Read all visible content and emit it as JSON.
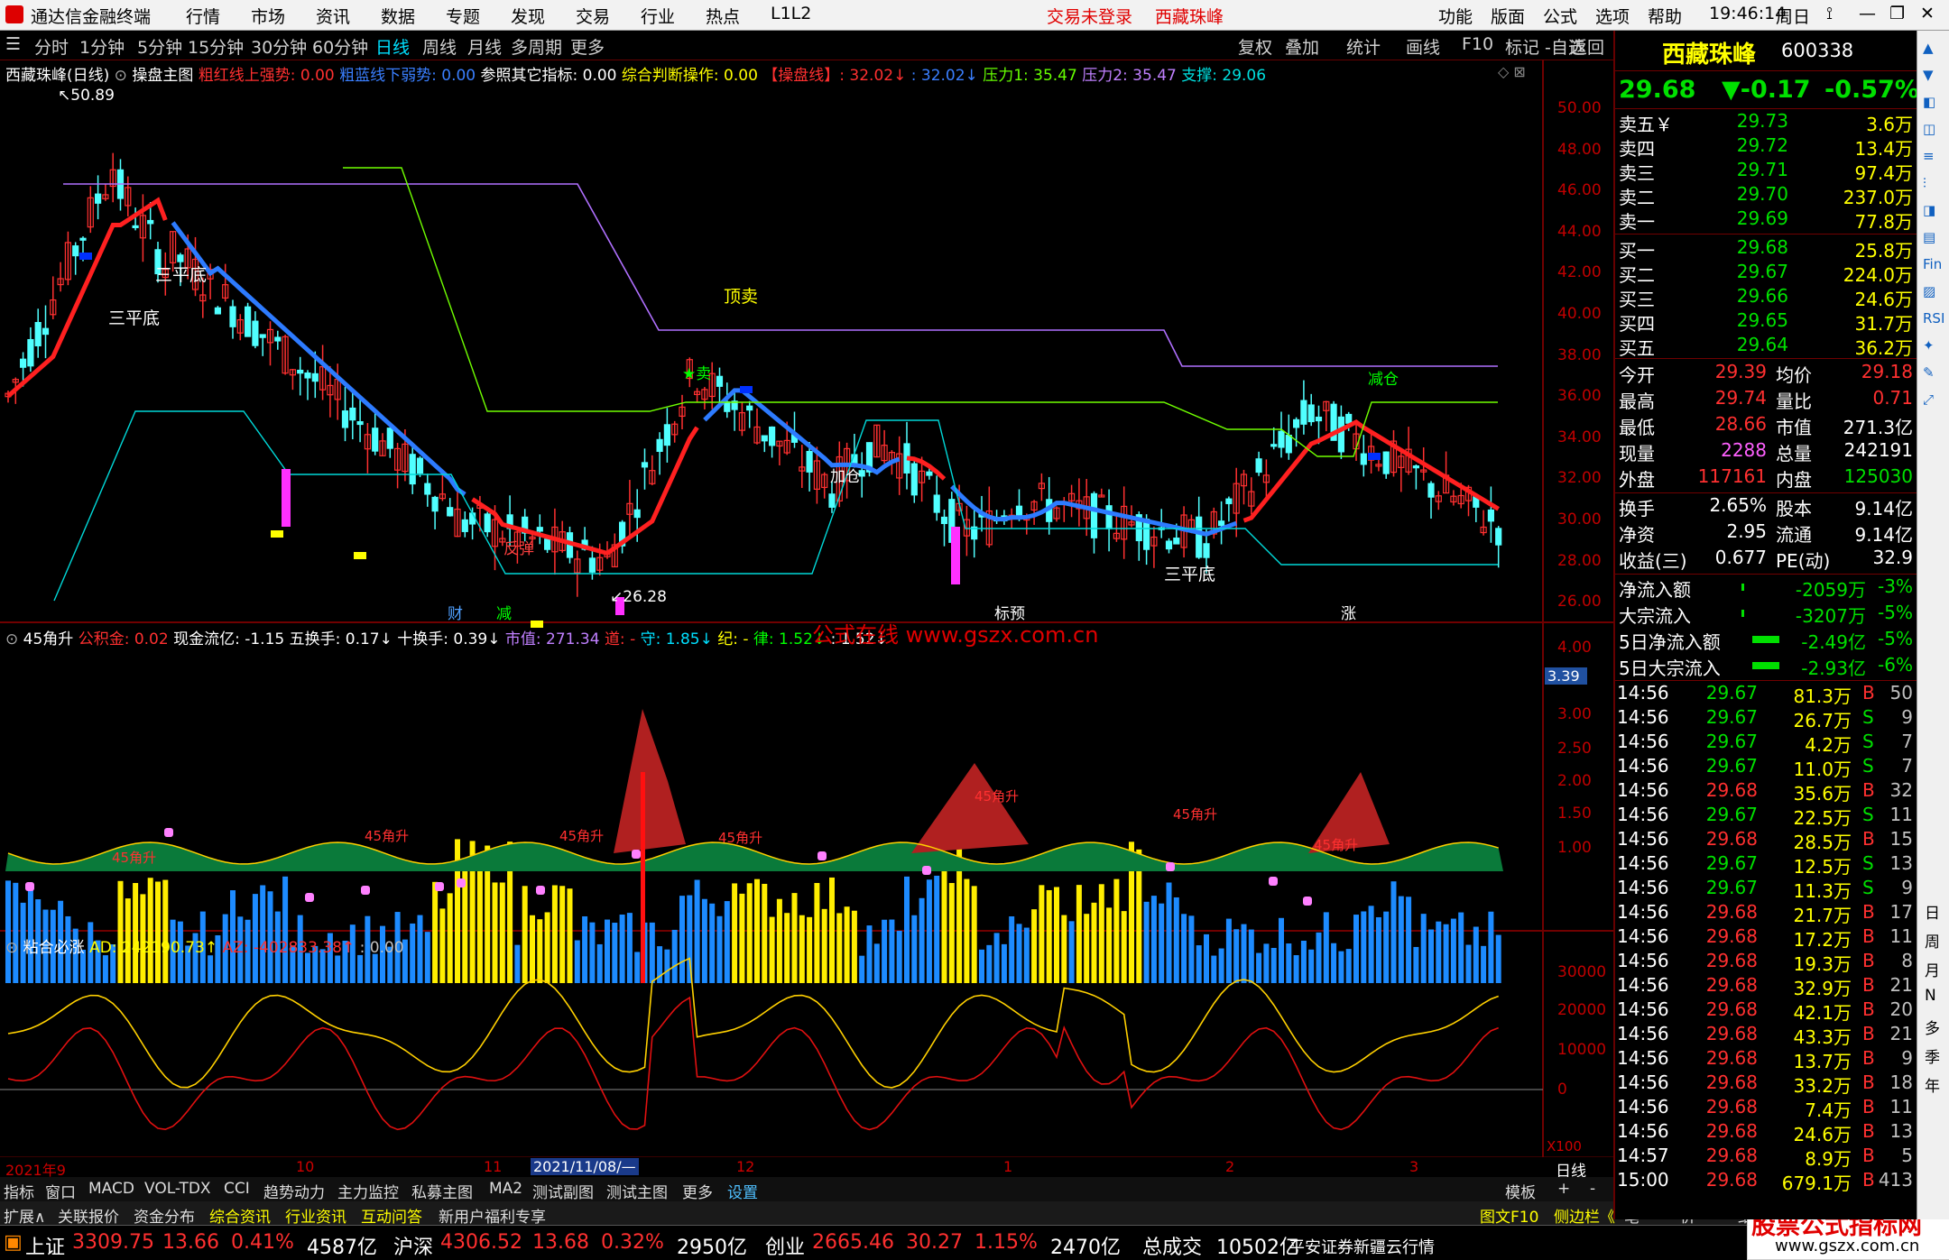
{
  "titlebar": {
    "app_name": "通达信金融终端",
    "menu": [
      "行情",
      "市场",
      "资讯",
      "数据",
      "专题",
      "发现",
      "交易",
      "行业",
      "热点",
      "L1L2"
    ],
    "login_status": "交易未登录",
    "stock_name": "西藏珠峰",
    "right_menu": [
      "功能",
      "版面",
      "公式",
      "选项",
      "帮助"
    ],
    "time": "19:46:14",
    "weekday": "周日"
  },
  "toolbar": {
    "periods": [
      "分时",
      "1分钟",
      "5分钟",
      "15分钟",
      "30分钟",
      "60分钟",
      "日线",
      "周线",
      "月线",
      "多周期",
      "更多"
    ],
    "active": "日线",
    "right_buttons": [
      "复权",
      "叠加",
      "统计",
      "画线",
      "F10",
      "标记",
      "-自选",
      "返回"
    ]
  },
  "main_chart": {
    "header": {
      "title": "西藏珠峰(日线)",
      "formula": "操盘主图",
      "items": [
        {
          "t": "粗红线上强势: 0.00",
          "c": "#ff3030"
        },
        {
          "t": "粗蓝线下弱势: 0.00",
          "c": "#3a7fff"
        },
        {
          "t": "参照其它指标: 0.00",
          "c": "#ffffff"
        },
        {
          "t": "综合判断操作: 0.00",
          "c": "#ffff00"
        },
        {
          "t": "【操盘线】: 32.02↓",
          "c": "#ff3030"
        },
        {
          "t": ": 32.02↓",
          "c": "#3a7fff"
        },
        {
          "t": "压力1: 35.47",
          "c": "#66ff00"
        },
        {
          "t": "压力2: 35.47",
          "c": "#c080ff"
        },
        {
          "t": "支撑: 29.06",
          "c": "#00e0e0"
        }
      ]
    },
    "y_labels": [
      "50.00",
      "48.00",
      "46.00",
      "44.00",
      "42.00",
      "40.00",
      "38.00",
      "36.00",
      "34.00",
      "32.00",
      "30.00",
      "28.00",
      "26.00"
    ],
    "high_label": "50.89",
    "low_label": "26.28",
    "annotations": [
      {
        "t": "三平底",
        "c": "#ffffff"
      },
      {
        "t": "三平底",
        "c": "#ffffff"
      },
      {
        "t": "顶卖",
        "c": "#ffff00"
      },
      {
        "t": "★卖",
        "c": "#00ff00"
      },
      {
        "t": "减仓",
        "c": "#ffffff"
      },
      {
        "t": "三平底",
        "c": "#ffffff"
      },
      {
        "t": "反弹",
        "c": "#ff4040"
      },
      {
        "t": "加仓",
        "c": "#ffffff"
      },
      {
        "t": "财",
        "c": "#4fa0ff"
      },
      {
        "t": "减",
        "c": "#00ff00"
      },
      {
        "t": "标预",
        "c": "#ffffff"
      },
      {
        "t": "涨",
        "c": "#ffffff"
      }
    ]
  },
  "ind1": {
    "title": "45角升",
    "items": [
      {
        "t": "公积金: 0.02",
        "c": "#ff3030"
      },
      {
        "t": "现金流亿: -1.15",
        "c": "#ffffff"
      },
      {
        "t": "五换手: 0.17↓",
        "c": "#ffffff"
      },
      {
        "t": "十换手: 0.39↓",
        "c": "#ffffff"
      },
      {
        "t": "市值: 271.34",
        "c": "#c080ff"
      },
      {
        "t": "道: -",
        "c": "#ff3030"
      },
      {
        "t": "守: 1.85↓",
        "c": "#00e0ff"
      },
      {
        "t": "纪: -",
        "c": "#ffff00"
      },
      {
        "t": "律: 1.52↓",
        "c": "#00ff00"
      },
      {
        "t": ": 1.52↓",
        "c": "#ffffff"
      }
    ],
    "watermark": "公式在线   www.gszx.com.cn",
    "y_labels": [
      "4.00",
      "3.00",
      "2.50",
      "2.00",
      "1.50",
      "1.00"
    ],
    "current_value": "3.39",
    "bar_label": "45角升"
  },
  "ind2": {
    "title": "粘合必涨",
    "items": [
      {
        "t": "AD: 242190.73↑",
        "c": "#ffff00"
      },
      {
        "t": "AZ: -402833.38↑",
        "c": "#ff3030"
      },
      {
        "t": ": 0.00",
        "c": "#c0c0c0"
      }
    ],
    "y_labels": [
      "30000",
      "20000",
      "10000",
      "0"
    ],
    "scale_label": "X100"
  },
  "xaxis": {
    "labels": [
      "2021年9",
      "10",
      "11",
      "2021/11/08/—",
      "12",
      "1",
      "2",
      "3"
    ],
    "period_label": "日线"
  },
  "tabs": [
    "指标",
    "窗口",
    "MACD",
    "VOL-TDX",
    "CCI",
    "趋势动力",
    "主力监控",
    "私募主图",
    "MA2",
    "测试副图",
    "测试主图",
    "更多",
    "设置"
  ],
  "tabs_right": [
    "模板",
    "+",
    "-"
  ],
  "tabs2": [
    "扩展∧",
    "关联报价",
    "资金分布",
    "综合资讯",
    "行业资讯",
    "互动问答",
    "新用户福利专享"
  ],
  "tabs2_right": [
    "图文F10",
    "侧边栏《",
    "笔",
    "价",
    "细",
    "势"
  ],
  "quote": {
    "name": "西藏珠峰",
    "code": "600338",
    "price": "29.68",
    "change": "▼-0.17",
    "pct": "-0.57%",
    "asks": [
      {
        "l": "卖五￥",
        "p": "29.73",
        "v": "3.6万"
      },
      {
        "l": "卖四",
        "p": "29.72",
        "v": "13.4万"
      },
      {
        "l": "卖三",
        "p": "29.71",
        "v": "97.4万"
      },
      {
        "l": "卖二",
        "p": "29.70",
        "v": "237.0万"
      },
      {
        "l": "卖一",
        "p": "29.69",
        "v": "77.8万"
      }
    ],
    "bids": [
      {
        "l": "买一",
        "p": "29.68",
        "v": "25.8万"
      },
      {
        "l": "买二",
        "p": "29.67",
        "v": "224.0万"
      },
      {
        "l": "买三",
        "p": "29.66",
        "v": "24.6万"
      },
      {
        "l": "买四",
        "p": "29.65",
        "v": "31.7万"
      },
      {
        "l": "买五",
        "p": "29.64",
        "v": "36.2万"
      }
    ],
    "stats": [
      {
        "l1": "今开",
        "v1": "29.39",
        "c1": "#ff3030",
        "l2": "均价",
        "v2": "29.18",
        "c2": "#ff3030"
      },
      {
        "l1": "最高",
        "v1": "29.74",
        "c1": "#ff3030",
        "l2": "量比",
        "v2": "0.71",
        "c2": "#ff3030"
      },
      {
        "l1": "最低",
        "v1": "28.66",
        "c1": "#ff3030",
        "l2": "市值",
        "v2": "271.3亿",
        "c2": "#ffffff"
      },
      {
        "l1": "现量",
        "v1": "2288",
        "c1": "#ff60ff",
        "l2": "总量",
        "v2": "242191",
        "c2": "#ffffff"
      },
      {
        "l1": "外盘",
        "v1": "117161",
        "c1": "#ff3030",
        "l2": "内盘",
        "v2": "125030",
        "c2": "#00e000"
      }
    ],
    "stats2": [
      {
        "l1": "换手",
        "v1": "2.65%",
        "l2": "股本",
        "v2": "9.14亿"
      },
      {
        "l1": "净资",
        "v1": "2.95",
        "l2": "流通",
        "v2": "9.14亿"
      },
      {
        "l1": "收益(三)",
        "v1": "0.677",
        "l2": "PE(动)",
        "v2": "32.9"
      }
    ],
    "flows": [
      {
        "l": "净流入额",
        "v": "-2059万",
        "p": "-3%"
      },
      {
        "l": "大宗流入",
        "v": "-3207万",
        "p": "-5%"
      },
      {
        "l": "5日净流入额",
        "v": "-2.49亿",
        "p": "-5%"
      },
      {
        "l": "5日大宗流入",
        "v": "-2.93亿",
        "p": "-6%"
      }
    ],
    "ticks": [
      {
        "t": "14:56",
        "p": "29.67",
        "v": "81.3万",
        "s": "B",
        "n": "50"
      },
      {
        "t": "14:56",
        "p": "29.67",
        "v": "26.7万",
        "s": "S",
        "n": "9"
      },
      {
        "t": "14:56",
        "p": "29.67",
        "v": "4.2万",
        "s": "S",
        "n": "7"
      },
      {
        "t": "14:56",
        "p": "29.67",
        "v": "11.0万",
        "s": "S",
        "n": "7"
      },
      {
        "t": "14:56",
        "p": "29.68",
        "v": "35.6万",
        "s": "B",
        "n": "32"
      },
      {
        "t": "14:56",
        "p": "29.67",
        "v": "22.5万",
        "s": "S",
        "n": "11"
      },
      {
        "t": "14:56",
        "p": "29.68",
        "v": "28.5万",
        "s": "B",
        "n": "15"
      },
      {
        "t": "14:56",
        "p": "29.67",
        "v": "12.5万",
        "s": "S",
        "n": "13"
      },
      {
        "t": "14:56",
        "p": "29.67",
        "v": "11.3万",
        "s": "S",
        "n": "9"
      },
      {
        "t": "14:56",
        "p": "29.68",
        "v": "21.7万",
        "s": "B",
        "n": "17"
      },
      {
        "t": "14:56",
        "p": "29.68",
        "v": "17.2万",
        "s": "B",
        "n": "11"
      },
      {
        "t": "14:56",
        "p": "29.68",
        "v": "19.3万",
        "s": "B",
        "n": "8"
      },
      {
        "t": "14:56",
        "p": "29.68",
        "v": "32.9万",
        "s": "B",
        "n": "21"
      },
      {
        "t": "14:56",
        "p": "29.68",
        "v": "42.1万",
        "s": "B",
        "n": "20"
      },
      {
        "t": "14:56",
        "p": "29.68",
        "v": "43.3万",
        "s": "B",
        "n": "21"
      },
      {
        "t": "14:56",
        "p": "29.68",
        "v": "13.7万",
        "s": "B",
        "n": "9"
      },
      {
        "t": "14:56",
        "p": "29.68",
        "v": "33.2万",
        "s": "B",
        "n": "18"
      },
      {
        "t": "14:56",
        "p": "29.68",
        "v": "7.4万",
        "s": "B",
        "n": "11"
      },
      {
        "t": "14:56",
        "p": "29.68",
        "v": "24.6万",
        "s": "B",
        "n": "13"
      },
      {
        "t": "14:57",
        "p": "29.68",
        "v": "8.9万",
        "s": "B",
        "n": "5"
      },
      {
        "t": "15:00",
        "p": "29.68",
        "v": "679.1万",
        "s": "B",
        "n": "413"
      }
    ]
  },
  "sidebar": [
    "日",
    "周",
    "月",
    "N",
    "多",
    "季",
    "年"
  ],
  "status": {
    "sh_name": "上证",
    "sh": "3309.75",
    "sh_chg": "13.66",
    "sh_pct": "0.41%",
    "sh_amt": "4587亿",
    "sz_name": "沪深",
    "sz": "4306.52",
    "sz_chg": "13.68",
    "sz_pct": "0.32%",
    "sz_amt": "2950亿",
    "cy_name": "创业",
    "cy": "2665.46",
    "cy_chg": "30.27",
    "cy_pct": "1.15%",
    "cy_amt": "2470亿",
    "total_label": "总成交",
    "total": "10502亿",
    "source": "平安证券新疆云行情",
    "brand": "股票公式指标网",
    "brand_url": "www.gszx.com.cn"
  }
}
